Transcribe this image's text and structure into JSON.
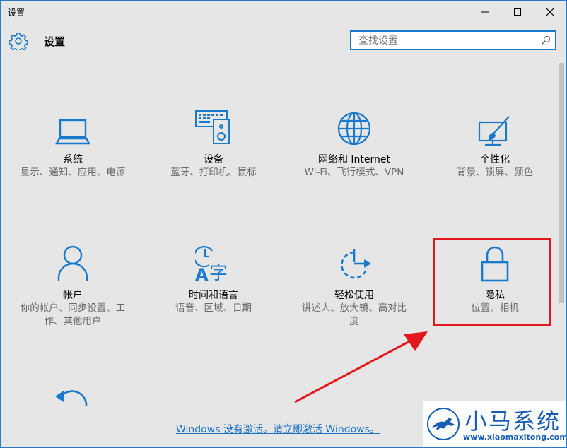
{
  "window": {
    "title": "设置"
  },
  "header": {
    "title": "设置"
  },
  "search": {
    "placeholder": "查找设置"
  },
  "tiles": [
    {
      "name": "系统",
      "desc": "显示、通知、应用、电源"
    },
    {
      "name": "设备",
      "desc": "蓝牙、打印机、鼠标"
    },
    {
      "name": "网络和 Internet",
      "desc": "Wi-Fi、飞行模式、VPN"
    },
    {
      "name": "个性化",
      "desc": "背景、锁屏、颜色"
    },
    {
      "name": "帐户",
      "desc": "你的帐户、同步设置、工作、其他用户"
    },
    {
      "name": "时间和语言",
      "desc": "语音、区域、日期"
    },
    {
      "name": "轻松使用",
      "desc": "讲述人、放大镜、高对比度"
    },
    {
      "name": "隐私",
      "desc": "位置、相机"
    }
  ],
  "activation": {
    "text": "Windows 没有激活。请立即激活 Windows。"
  },
  "watermark": {
    "brand": "小马系统",
    "url": "www.xiaomaxitong.com"
  },
  "colors": {
    "accent": "#1979ca",
    "highlight": "#e3181d"
  }
}
